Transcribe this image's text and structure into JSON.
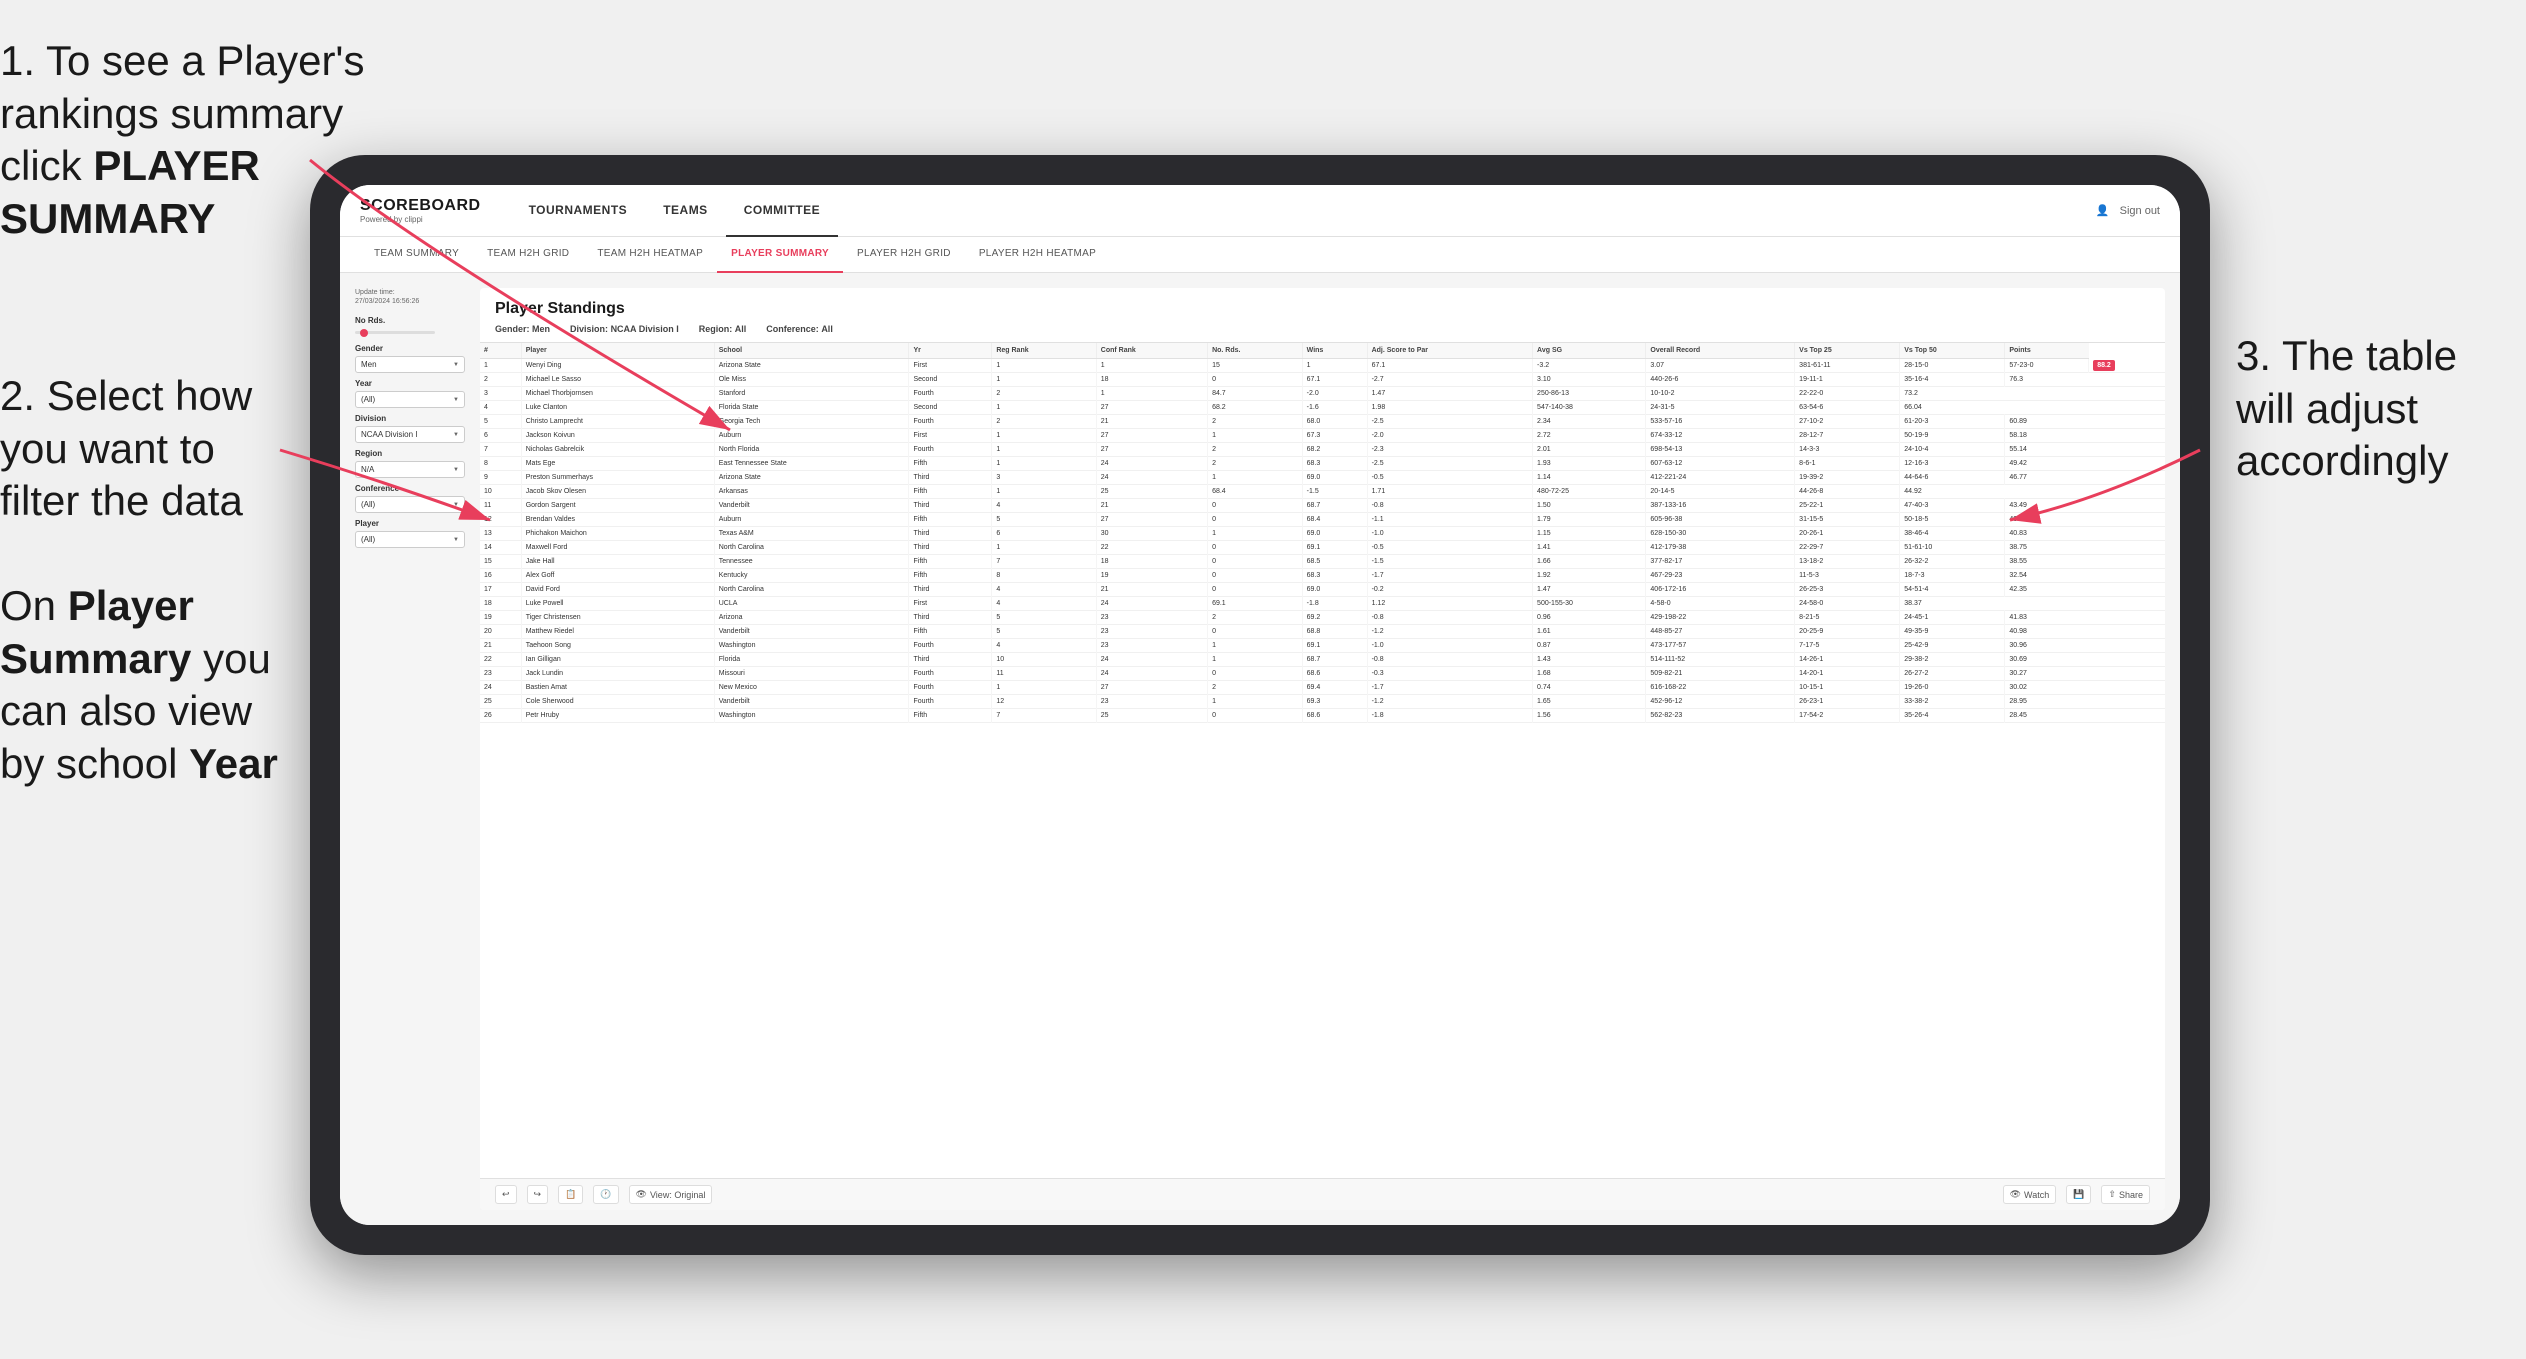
{
  "annotations": {
    "top_left": {
      "number": "1.",
      "text": " To see a Player's rankings summary click ",
      "bold": "PLAYER SUMMARY"
    },
    "mid_left": {
      "number": "2.",
      "text": " Select how you want to filter the data"
    },
    "bottom_left": {
      "text_start": "On ",
      "bold1": "Player Summary",
      "text_mid": " you can also view by school ",
      "bold2": "Year"
    },
    "right": {
      "number": "3.",
      "text": " The table will adjust accordingly"
    }
  },
  "app": {
    "logo": "SCOREBOARD",
    "logo_sub": "Powered by clippi",
    "nav_items": [
      "TOURNAMENTS",
      "TEAMS",
      "COMMITTEE"
    ],
    "header_right_icon": "user-icon",
    "sign_out": "Sign out",
    "sub_nav": [
      "TEAM SUMMARY",
      "TEAM H2H GRID",
      "TEAM H2H HEATMAP",
      "PLAYER SUMMARY",
      "PLAYER H2H GRID",
      "PLAYER H2H HEATMAP"
    ]
  },
  "filters": {
    "update_time_label": "Update time:",
    "update_time_value": "27/03/2024 16:56:26",
    "no_rds_label": "No Rds.",
    "gender_label": "Gender",
    "gender_value": "Men",
    "year_label": "Year",
    "year_value": "(All)",
    "division_label": "Division",
    "division_value": "NCAA Division I",
    "region_label": "Region",
    "region_value": "N/A",
    "conference_label": "Conference",
    "conference_value": "(All)",
    "player_label": "Player",
    "player_value": "(All)"
  },
  "table": {
    "title": "Player Standings",
    "gender_label": "Gender:",
    "gender_value": "Men",
    "division_label": "Division:",
    "division_value": "NCAA Division I",
    "region_label": "Region:",
    "region_value": "All",
    "conference_label": "Conference:",
    "conference_value": "All",
    "columns": [
      "#",
      "Player",
      "School",
      "Yr",
      "Reg Rank",
      "Conf Rank",
      "No. Rds.",
      "Wins",
      "Adj. Score to Par",
      "Avg SG",
      "Overall Record",
      "Vs Top 25",
      "Vs Top 50",
      "Points"
    ],
    "rows": [
      [
        "1",
        "Wenyi Ding",
        "Arizona State",
        "First",
        "1",
        "1",
        "15",
        "1",
        "67.1",
        "-3.2",
        "3.07",
        "381-61-11",
        "28-15-0",
        "57-23-0",
        "88.2"
      ],
      [
        "2",
        "Michael Le Sasso",
        "Ole Miss",
        "Second",
        "1",
        "18",
        "0",
        "67.1",
        "-2.7",
        "3.10",
        "440-26-6",
        "19-11-1",
        "35-16-4",
        "76.3"
      ],
      [
        "3",
        "Michael Thorbjornsen",
        "Stanford",
        "Fourth",
        "2",
        "1",
        "84.7",
        "-2.0",
        "1.47",
        "250-86-13",
        "10-10-2",
        "22-22-0",
        "73.2"
      ],
      [
        "4",
        "Luke Clanton",
        "Florida State",
        "Second",
        "1",
        "27",
        "68.2",
        "-1.6",
        "1.98",
        "547-140-38",
        "24-31-5",
        "63-54-6",
        "66.04"
      ],
      [
        "5",
        "Christo Lamprecht",
        "Georgia Tech",
        "Fourth",
        "2",
        "21",
        "2",
        "68.0",
        "-2.5",
        "2.34",
        "533-57-16",
        "27-10-2",
        "61-20-3",
        "60.89"
      ],
      [
        "6",
        "Jackson Koivun",
        "Auburn",
        "First",
        "1",
        "27",
        "1",
        "67.3",
        "-2.0",
        "2.72",
        "674-33-12",
        "28-12-7",
        "50-19-9",
        "58.18"
      ],
      [
        "7",
        "Nicholas Gabrelcik",
        "North Florida",
        "Fourth",
        "1",
        "27",
        "2",
        "68.2",
        "-2.3",
        "2.01",
        "698-54-13",
        "14-3-3",
        "24-10-4",
        "55.14"
      ],
      [
        "8",
        "Mats Ege",
        "East Tennessee State",
        "Fifth",
        "1",
        "24",
        "2",
        "68.3",
        "-2.5",
        "1.93",
        "607-63-12",
        "8-6-1",
        "12-16-3",
        "49.42"
      ],
      [
        "9",
        "Preston Summerhays",
        "Arizona State",
        "Third",
        "3",
        "24",
        "1",
        "69.0",
        "-0.5",
        "1.14",
        "412-221-24",
        "19-39-2",
        "44-64-6",
        "46.77"
      ],
      [
        "10",
        "Jacob Skov Olesen",
        "Arkansas",
        "Fifth",
        "1",
        "25",
        "68.4",
        "-1.5",
        "1.71",
        "480-72-25",
        "20-14-5",
        "44-26-8",
        "44.92"
      ],
      [
        "11",
        "Gordon Sargent",
        "Vanderbilt",
        "Third",
        "4",
        "21",
        "0",
        "68.7",
        "-0.8",
        "1.50",
        "387-133-16",
        "25-22-1",
        "47-40-3",
        "43.49"
      ],
      [
        "12",
        "Brendan Valdes",
        "Auburn",
        "Fifth",
        "5",
        "27",
        "0",
        "68.4",
        "-1.1",
        "1.79",
        "605-96-38",
        "31-15-5",
        "50-18-5",
        "40.96"
      ],
      [
        "13",
        "Phichakon Maichon",
        "Texas A&M",
        "Third",
        "6",
        "30",
        "1",
        "69.0",
        "-1.0",
        "1.15",
        "628-150-30",
        "20-26-1",
        "38-46-4",
        "40.83"
      ],
      [
        "14",
        "Maxwell Ford",
        "North Carolina",
        "Third",
        "1",
        "22",
        "0",
        "69.1",
        "-0.5",
        "1.41",
        "412-179-38",
        "22-29-7",
        "51-61-10",
        "38.75"
      ],
      [
        "15",
        "Jake Hall",
        "Tennessee",
        "Fifth",
        "7",
        "18",
        "0",
        "68.5",
        "-1.5",
        "1.66",
        "377-82-17",
        "13-18-2",
        "26-32-2",
        "38.55"
      ],
      [
        "16",
        "Alex Goff",
        "Kentucky",
        "Fifth",
        "8",
        "19",
        "0",
        "68.3",
        "-1.7",
        "1.92",
        "467-29-23",
        "11-5-3",
        "18-7-3",
        "32.54"
      ],
      [
        "17",
        "David Ford",
        "North Carolina",
        "Third",
        "4",
        "21",
        "0",
        "69.0",
        "-0.2",
        "1.47",
        "406-172-16",
        "26-25-3",
        "54-51-4",
        "42.35"
      ],
      [
        "18",
        "Luke Powell",
        "UCLA",
        "First",
        "4",
        "24",
        "69.1",
        "-1.8",
        "1.12",
        "500-155-30",
        "4-58-0",
        "24-58-0",
        "38.37"
      ],
      [
        "19",
        "Tiger Christensen",
        "Arizona",
        "Third",
        "5",
        "23",
        "2",
        "69.2",
        "-0.8",
        "0.96",
        "429-198-22",
        "8-21-5",
        "24-45-1",
        "41.83"
      ],
      [
        "20",
        "Matthew Riedel",
        "Vanderbilt",
        "Fifth",
        "5",
        "23",
        "0",
        "68.8",
        "-1.2",
        "1.61",
        "448-85-27",
        "20-25-9",
        "49-35-9",
        "40.98"
      ],
      [
        "21",
        "Taehoon Song",
        "Washington",
        "Fourth",
        "4",
        "23",
        "1",
        "69.1",
        "-1.0",
        "0.87",
        "473-177-57",
        "7-17-5",
        "25-42-9",
        "30.96"
      ],
      [
        "22",
        "Ian Gilligan",
        "Florida",
        "Third",
        "10",
        "24",
        "1",
        "68.7",
        "-0.8",
        "1.43",
        "514-111-52",
        "14-26-1",
        "29-38-2",
        "30.69"
      ],
      [
        "23",
        "Jack Lundin",
        "Missouri",
        "Fourth",
        "11",
        "24",
        "0",
        "68.6",
        "-0.3",
        "1.68",
        "509-82-21",
        "14-20-1",
        "26-27-2",
        "30.27"
      ],
      [
        "24",
        "Bastien Amat",
        "New Mexico",
        "Fourth",
        "1",
        "27",
        "2",
        "69.4",
        "-1.7",
        "0.74",
        "616-168-22",
        "10-15-1",
        "19-26-0",
        "30.02"
      ],
      [
        "25",
        "Cole Sherwood",
        "Vanderbilt",
        "Fourth",
        "12",
        "23",
        "1",
        "69.3",
        "-1.2",
        "1.65",
        "452-96-12",
        "26-23-1",
        "33-38-2",
        "28.95"
      ],
      [
        "26",
        "Petr Hruby",
        "Washington",
        "Fifth",
        "7",
        "25",
        "0",
        "68.6",
        "-1.8",
        "1.56",
        "562-82-23",
        "17-54-2",
        "35-26-4",
        "28.45"
      ]
    ]
  },
  "toolbar": {
    "view_label": "View: Original",
    "watch_label": "Watch",
    "share_label": "Share"
  }
}
